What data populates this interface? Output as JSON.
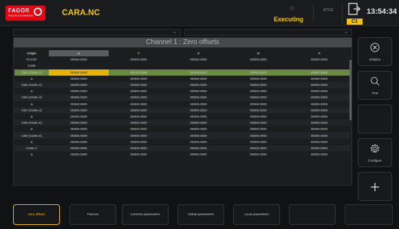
{
  "header": {
    "logo_text": "FAGOR",
    "logo_sub": "FAGOR AUTOMATION",
    "program": "CARA.NC",
    "status": "Executing",
    "ntc_label": "NT131",
    "channel_badge": "C1",
    "clock": "13:54:34"
  },
  "panel": {
    "title": "Channel 1 : Zero offsets",
    "columns": [
      "Origin",
      "X",
      "Y",
      "Z",
      "U",
      "V"
    ],
    "rows": [
      {
        "label": "PLCOF",
        "values": [
          "00000.0000",
          "00000.0000",
          "00000.0000",
          "00000.0000",
          "00000.0000"
        ]
      },
      {
        "label": "G158",
        "values": [
          "",
          "",
          "",
          "",
          ""
        ]
      },
      {
        "label": "G54 (G159=1)",
        "values": [
          "00250.0000",
          "00160.0000",
          "00200.0000",
          "00000.0000",
          "00000.0000"
        ]
      },
      {
        "label": "Δ",
        "values": [
          "00000.0000",
          "00000.0000",
          "00000.0000",
          "00000.0000",
          "00000.0000"
        ]
      },
      {
        "label": "G55 (G159=2)",
        "values": [
          "00000.0000",
          "00000.0000",
          "00000.0000",
          "00000.0000",
          "00000.0000"
        ]
      },
      {
        "label": "Δ",
        "values": [
          "00000.0000",
          "00000.0000",
          "00000.0000",
          "00000.0000",
          "00000.0000"
        ]
      },
      {
        "label": "G56 (G159=3)",
        "values": [
          "00000.0000",
          "00000.0000",
          "00000.0000",
          "00000.0000",
          "00000.0000"
        ]
      },
      {
        "label": "Δ",
        "values": [
          "00000.0000",
          "00000.0000",
          "00000.0000",
          "00000.0000",
          "00000.0000"
        ]
      },
      {
        "label": "G57 (G159=4)",
        "values": [
          "00000.0000",
          "00000.0000",
          "00000.0000",
          "00000.0000",
          "00000.0000"
        ]
      },
      {
        "label": "Δ",
        "values": [
          "00000.0000",
          "00000.0000",
          "00000.0000",
          "00000.0000",
          "00000.0000"
        ]
      },
      {
        "label": "G58 (G159=5)",
        "values": [
          "00000.0000",
          "00000.0000",
          "00000.0000",
          "00000.0000",
          "00000.0000"
        ]
      },
      {
        "label": "Δ",
        "values": [
          "00000.0000",
          "00000.0000",
          "00000.0000",
          "00000.0000",
          "00000.0000"
        ]
      },
      {
        "label": "G59 (G159=6)",
        "values": [
          "00000.0000",
          "00000.0000",
          "00000.0000",
          "00000.0000",
          "00000.0000"
        ]
      },
      {
        "label": "Δ",
        "values": [
          "00000.0000",
          "00000.0000",
          "00000.0000",
          "00000.0000",
          "00000.0000"
        ]
      },
      {
        "label": "G159=7",
        "values": [
          "00000.0000",
          "00000.0000",
          "00000.0000",
          "00000.0000",
          "00000.0000"
        ]
      },
      {
        "label": "Δ",
        "values": [
          "00000.0000",
          "00000.0000",
          "00000.0000",
          "00000.0000",
          "00000.0000"
        ]
      }
    ]
  },
  "right_keys": [
    {
      "icon": "close-circle-icon",
      "label": "Initialize"
    },
    {
      "icon": "search-icon",
      "label": "Find"
    },
    {
      "icon": "",
      "label": ""
    },
    {
      "icon": "gear-icon",
      "label": "Configure"
    },
    {
      "icon": "plus-icon",
      "label": ""
    }
  ],
  "bottom_keys": [
    "Zero offsets",
    "Fixtures",
    "Common parameters",
    "Global parameters",
    "Local parameters",
    "",
    ""
  ],
  "colors": {
    "accent": "#f5c400",
    "selected_row": "#6a8a3d",
    "brand": "#e30613"
  }
}
